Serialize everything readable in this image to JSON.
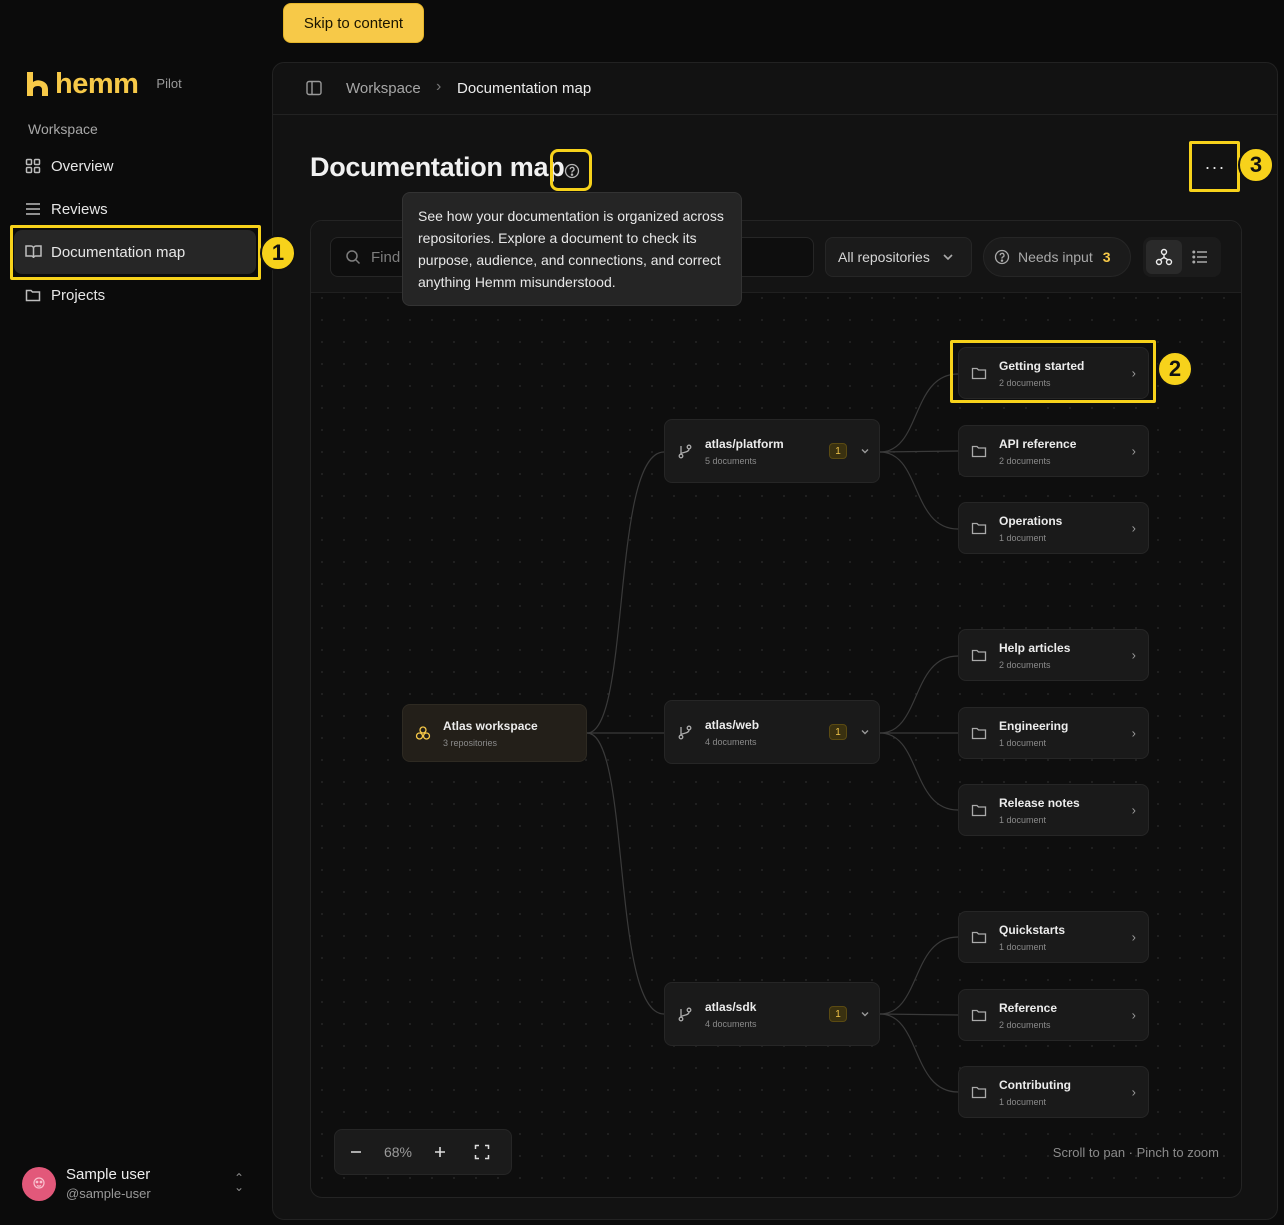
{
  "skip_link": "Skip to content",
  "brand": {
    "name": "hemm",
    "badge": "Pilot"
  },
  "sidebar": {
    "section": "Workspace",
    "items": [
      {
        "label": "Overview",
        "icon": "grid-icon"
      },
      {
        "label": "Reviews",
        "icon": "list-icon"
      },
      {
        "label": "Documentation map",
        "icon": "book-icon",
        "active": true
      },
      {
        "label": "Projects",
        "icon": "folder-icon"
      }
    ]
  },
  "user": {
    "name": "Sample user",
    "handle": "@sample-user"
  },
  "breadcrumb": {
    "parent": "Workspace",
    "separator": "›",
    "current": "Documentation map"
  },
  "page": {
    "title": "Documentation map",
    "more_label": "···",
    "tooltip": "See how your documentation is organized across repositories. Explore a document to check its purpose, audience, and connections, and correct anything Hemm misunderstood."
  },
  "toolbar": {
    "search_placeholder": "Find",
    "repo_filter": "All repositories",
    "needs_input_label": "Needs input",
    "needs_input_count": "3"
  },
  "map": {
    "root": {
      "title": "Atlas workspace",
      "subtitle": "3 repositories"
    },
    "repos": [
      {
        "title": "atlas/platform",
        "subtitle": "5 documents",
        "badge": "1",
        "folders": [
          {
            "title": "Getting started",
            "subtitle": "2 documents"
          },
          {
            "title": "API reference",
            "subtitle": "2 documents"
          },
          {
            "title": "Operations",
            "subtitle": "1 document"
          }
        ]
      },
      {
        "title": "atlas/web",
        "subtitle": "4 documents",
        "badge": "1",
        "folders": [
          {
            "title": "Help articles",
            "subtitle": "2 documents"
          },
          {
            "title": "Engineering",
            "subtitle": "1 document"
          },
          {
            "title": "Release notes",
            "subtitle": "1 document"
          }
        ]
      },
      {
        "title": "atlas/sdk",
        "subtitle": "4 documents",
        "badge": "1",
        "folders": [
          {
            "title": "Quickstarts",
            "subtitle": "1 document"
          },
          {
            "title": "Reference",
            "subtitle": "2 documents"
          },
          {
            "title": "Contributing",
            "subtitle": "1 document"
          }
        ]
      }
    ],
    "zoom": "68%",
    "hint": "Scroll to pan · Pinch to zoom"
  },
  "annotations": [
    "1",
    "2",
    "3"
  ],
  "colors": {
    "accent": "#f7c948",
    "highlight": "#f7d21b",
    "background": "#0b0b0b"
  }
}
